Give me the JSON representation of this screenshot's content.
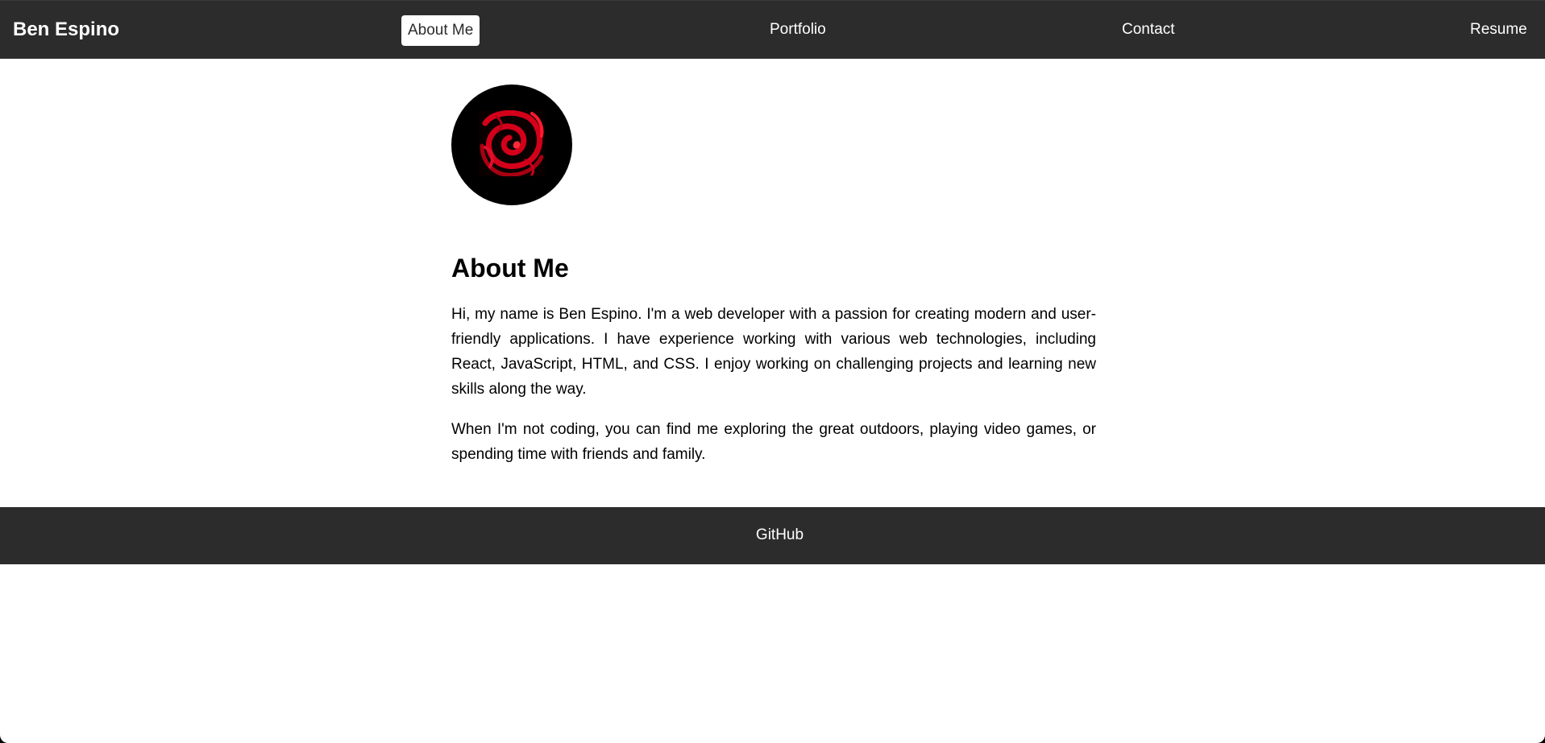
{
  "nav": {
    "brand": "Ben Espino",
    "links": [
      {
        "label": "About Me",
        "active": true
      },
      {
        "label": "Portfolio",
        "active": false
      },
      {
        "label": "Contact",
        "active": false
      },
      {
        "label": "Resume",
        "active": false
      }
    ]
  },
  "main": {
    "avatar_icon": "red-swirl-logo",
    "heading": "About Me",
    "paragraphs": [
      "Hi, my name is Ben Espino. I'm a web developer with a passion for creating modern and user-friendly applications. I have experience working with various web technologies, including React, JavaScript, HTML, and CSS. I enjoy working on challenging projects and learning new skills along the way.",
      "When I'm not coding, you can find me exploring the great outdoors, playing video games, or spending time with friends and family."
    ]
  },
  "footer": {
    "link": "GitHub"
  },
  "colors": {
    "bar_background": "#2c2c2c",
    "active_tab_background": "#ffffff",
    "avatar_accent": "#d4001a"
  }
}
